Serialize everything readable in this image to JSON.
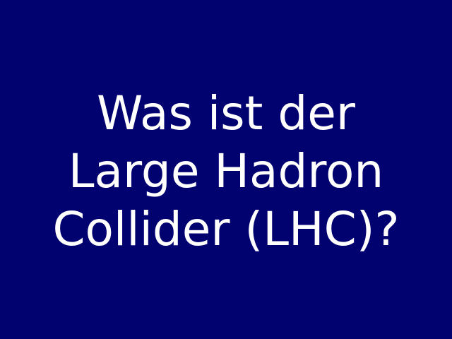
{
  "slide": {
    "background_color": "#010170",
    "text_color": "#ffffff",
    "question_lines": [
      "Was ist der",
      "Large Hadron",
      "Collider (LHC)?"
    ]
  }
}
